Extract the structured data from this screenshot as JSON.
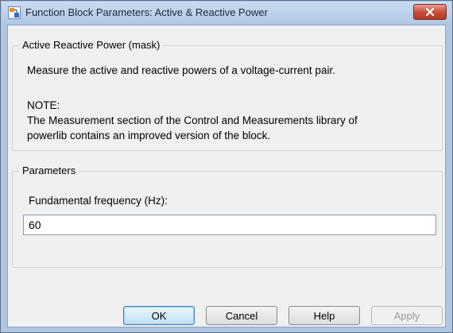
{
  "window": {
    "title": "Function Block Parameters: Active & Reactive Power"
  },
  "mask_group": {
    "title": "Active  Reactive Power  (mask)",
    "description": "Measure the active and reactive powers of a voltage-current pair.",
    "note_label": "NOTE:",
    "note_lines": [
      "The Measurement section of the Control and Measurements library of",
      "powerlib contains an improved version of the block."
    ]
  },
  "parameters_group": {
    "title": "Parameters",
    "frequency_label": "Fundamental frequency (Hz):",
    "frequency_value": "60"
  },
  "buttons": {
    "ok": "OK",
    "cancel": "Cancel",
    "help": "Help",
    "apply": "Apply"
  },
  "icons": {
    "app": "simulink-block-icon",
    "close": "close-x-icon"
  },
  "colors": {
    "titlebar": "#b1c8e4",
    "close_button": "#c74a36",
    "default_button_border": "#3c7fb1",
    "client_background": "#f0f0f0"
  }
}
